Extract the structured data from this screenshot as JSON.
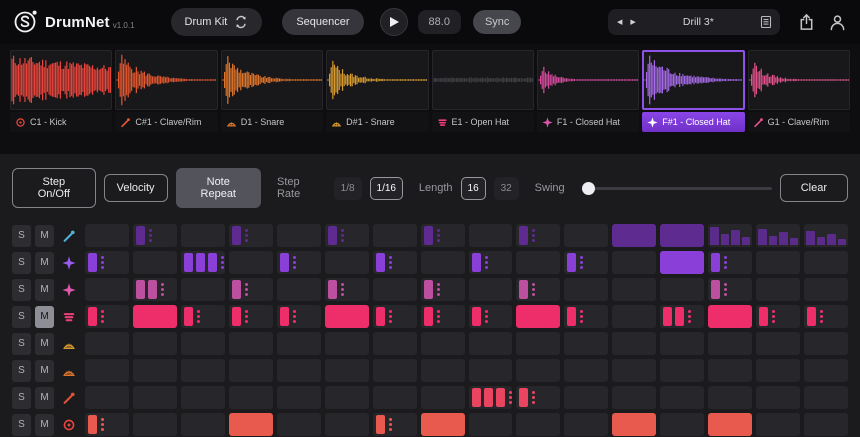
{
  "theme": {
    "accent": "#8a46e8"
  },
  "topbar": {
    "app_name": "DrumNet",
    "version": "v1.0.1",
    "drum_kit": "Drum Kit",
    "sequencer": "Sequencer",
    "bpm": "88.0",
    "sync": "Sync",
    "preset": "Drill 3*"
  },
  "pads": [
    {
      "label": "C1 - Kick",
      "icon": "kick",
      "icon_color": "#e8453c",
      "color": "#e8453c",
      "wave": "kick",
      "amp": 0.9,
      "rate": 0,
      "seed": 11,
      "selected": false
    },
    {
      "label": "C#1 - Clave/Rim",
      "icon": "stick",
      "icon_color": "#e2572f",
      "color": "#e2572f",
      "wave": "decay",
      "amp": 0.95,
      "rate": 4.5,
      "seed": 5,
      "selected": false
    },
    {
      "label": "D1 - Snare",
      "icon": "snare",
      "icon_color": "#e0762c",
      "color": "#e0762c",
      "wave": "decay",
      "amp": 0.9,
      "rate": 4.8,
      "seed": 9,
      "selected": false
    },
    {
      "label": "D#1 - Snare",
      "icon": "snare",
      "icon_color": "#d79a2e",
      "color": "#d79a2e",
      "wave": "decay",
      "amp": 0.72,
      "rate": 5.5,
      "seed": 13,
      "selected": false
    },
    {
      "label": "E1 - Open Hat",
      "icon": "openhat",
      "icon_color": "#ee3f78",
      "color": "#404045",
      "wave": "flat",
      "amp": 0.1,
      "rate": 1,
      "seed": 7,
      "selected": false
    },
    {
      "label": "F1 - Closed Hat",
      "icon": "closedhat",
      "icon_color": "#df58ae",
      "color": "#d84a9e",
      "wave": "decay",
      "amp": 0.5,
      "rate": 8,
      "seed": 3,
      "selected": false
    },
    {
      "label": "F#1 - Closed Hat",
      "icon": "closedhat",
      "icon_color": "#ffffff",
      "color": "#a66ae8",
      "wave": "decay",
      "amp": 0.95,
      "rate": 3.6,
      "seed": 8,
      "selected": true
    },
    {
      "label": "G1 - Clave/Rim",
      "icon": "stick",
      "icon_color": "#e0518b",
      "color": "#e0518b",
      "wave": "decay",
      "amp": 0.65,
      "rate": 6.5,
      "seed": 15,
      "selected": false
    }
  ],
  "controls": {
    "buttons": [
      {
        "label": "Step On/Off",
        "active": false
      },
      {
        "label": "Velocity",
        "active": false
      },
      {
        "label": "Note Repeat",
        "active": true
      }
    ],
    "step_rate": {
      "label": "Step Rate",
      "options": [
        "1/8",
        "1/16"
      ],
      "selected": "1/16"
    },
    "length": {
      "label": "Length",
      "options": [
        "16",
        "32"
      ],
      "selected": "16"
    },
    "swing": {
      "label": "Swing",
      "value": 0
    },
    "clear_label": "Clear"
  },
  "sequencer": {
    "solo_label": "S",
    "mute_label": "M",
    "columns": 16,
    "rows": [
      {
        "id": "G1",
        "icon": "stick",
        "icon_color": "#4fb3d9",
        "step_color": "#5e2b91",
        "solo": false,
        "muted": false,
        "steps": [
          "",
          "r",
          "",
          "r",
          "",
          "r",
          "",
          "r",
          "",
          "r",
          "",
          "s",
          "s",
          "v:95,58,78,42",
          "v:86,50,68,38",
          "v:72,44,58,30"
        ]
      },
      {
        "id": "F#1",
        "icon": "closedhat",
        "icon_color": "#9a5cf0",
        "step_color": "#8b3fd9",
        "solo": false,
        "muted": false,
        "steps": [
          "r",
          "",
          "rrr",
          "",
          "r",
          "",
          "r",
          "",
          "r",
          "",
          "r",
          "",
          "s",
          "r",
          "",
          ""
        ]
      },
      {
        "id": "F1",
        "icon": "closedhat",
        "icon_color": "#df58ae",
        "step_color": "#bc4f9e",
        "solo": false,
        "muted": false,
        "steps": [
          "",
          "rr",
          "",
          "r",
          "",
          "r",
          "",
          "r",
          "",
          "r",
          "",
          "",
          "",
          "r",
          "",
          ""
        ]
      },
      {
        "id": "E1",
        "icon": "openhat",
        "icon_color": "#ee3f78",
        "step_color": "#ee2e6b",
        "solo": false,
        "muted": true,
        "steps": [
          "r",
          "s",
          "r",
          "r",
          "r",
          "s",
          "r",
          "r",
          "r",
          "s",
          "r",
          "",
          "rr",
          "s",
          "r",
          "r"
        ]
      },
      {
        "id": "D#1",
        "icon": "snare",
        "icon_color": "#d79a2e",
        "step_color": "#d79a2e",
        "solo": false,
        "muted": false,
        "steps": [
          "",
          "",
          "",
          "",
          "",
          "",
          "",
          "",
          "",
          "",
          "",
          "",
          "",
          "",
          "",
          ""
        ]
      },
      {
        "id": "D1",
        "icon": "snare",
        "icon_color": "#e0762c",
        "step_color": "#e0762c",
        "solo": false,
        "muted": false,
        "steps": [
          "",
          "",
          "",
          "",
          "",
          "",
          "",
          "",
          "",
          "",
          "",
          "",
          "",
          "",
          "",
          ""
        ]
      },
      {
        "id": "C#1",
        "icon": "stick",
        "icon_color": "#e25335",
        "step_color": "#ea4560",
        "solo": false,
        "muted": false,
        "steps": [
          "",
          "",
          "",
          "",
          "",
          "",
          "",
          "",
          "rrr",
          "r",
          "",
          "",
          "",
          "",
          "",
          ""
        ]
      },
      {
        "id": "C1",
        "icon": "kick",
        "icon_color": "#e8453c",
        "step_color": "#e85a4e",
        "solo": false,
        "muted": false,
        "steps": [
          "r",
          "",
          "",
          "s",
          "",
          "",
          "r",
          "s",
          "",
          "",
          "",
          "s",
          "",
          "s",
          "",
          ""
        ]
      }
    ]
  }
}
